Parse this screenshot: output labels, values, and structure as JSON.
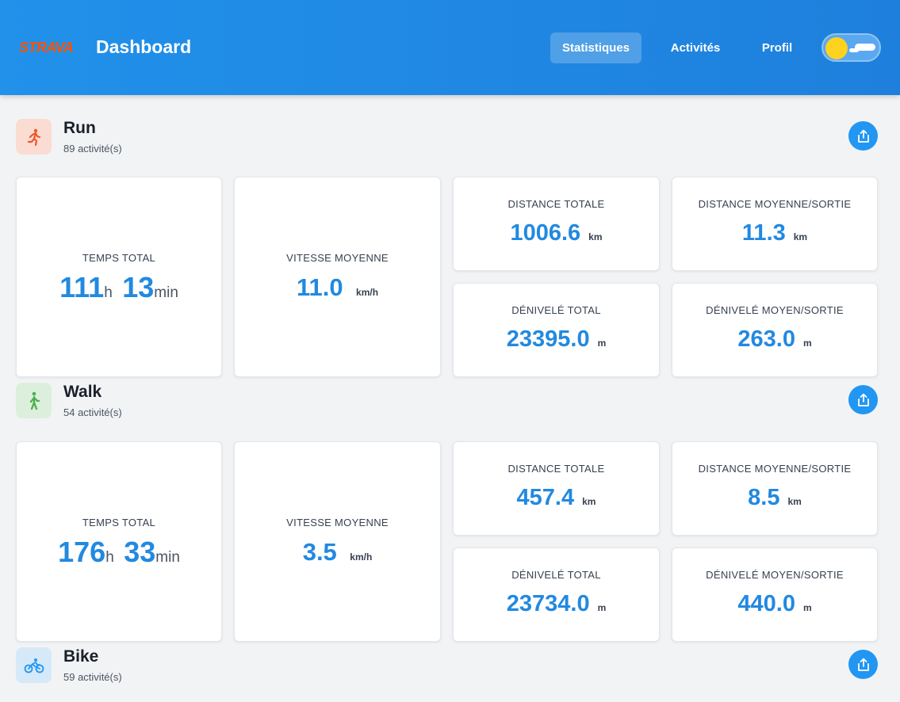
{
  "header": {
    "logo": "STRAVA",
    "title": "Dashboard",
    "nav": [
      {
        "label": "Statistiques",
        "active": true
      },
      {
        "label": "Activités",
        "active": false
      },
      {
        "label": "Profil",
        "active": false
      }
    ],
    "theme_toggle_icon": "sun-icon"
  },
  "colors": {
    "header": "#2191ea",
    "accent": "#2289e0",
    "strava": "#fc5200"
  },
  "sections": [
    {
      "name": "Run",
      "count": "89 activité(s)",
      "icon": "run-icon",
      "icon_bg": "#fadcd3",
      "icon_color": "#f0562b",
      "time": {
        "label": "TEMPS TOTAL",
        "hours": "111",
        "h_unit": "h",
        "minutes": "13",
        "min_unit": "min"
      },
      "speed": {
        "label": "VITESSE MOYENNE",
        "value": "11.0",
        "unit": "km/h"
      },
      "distance_total": {
        "label": "DISTANCE TOTALE",
        "value": "1006.6",
        "unit": "km"
      },
      "distance_avg": {
        "label": "DISTANCE MOYENNE/SORTIE",
        "value": "11.3",
        "unit": "km"
      },
      "elevation_total": {
        "label": "DÉNIVELÉ TOTAL",
        "value": "23395.0",
        "unit": "m"
      },
      "elevation_avg": {
        "label": "DÉNIVELÉ MOYEN/SORTIE",
        "value": "263.0",
        "unit": "m"
      }
    },
    {
      "name": "Walk",
      "count": "54 activité(s)",
      "icon": "walk-icon",
      "icon_bg": "#dcefdc",
      "icon_color": "#4caf50",
      "time": {
        "label": "TEMPS TOTAL",
        "hours": "176",
        "h_unit": "h",
        "minutes": "33",
        "min_unit": "min"
      },
      "speed": {
        "label": "VITESSE MOYENNE",
        "value": "3.5",
        "unit": "km/h"
      },
      "distance_total": {
        "label": "DISTANCE TOTALE",
        "value": "457.4",
        "unit": "km"
      },
      "distance_avg": {
        "label": "DISTANCE MOYENNE/SORTIE",
        "value": "8.5",
        "unit": "km"
      },
      "elevation_total": {
        "label": "DÉNIVELÉ TOTAL",
        "value": "23734.0",
        "unit": "m"
      },
      "elevation_avg": {
        "label": "DÉNIVELÉ MOYEN/SORTIE",
        "value": "440.0",
        "unit": "m"
      }
    },
    {
      "name": "Bike",
      "count": "59 activité(s)",
      "icon": "bike-icon",
      "icon_bg": "#d6e9f8",
      "icon_color": "#2196f3"
    }
  ],
  "share_icon": "share-icon"
}
